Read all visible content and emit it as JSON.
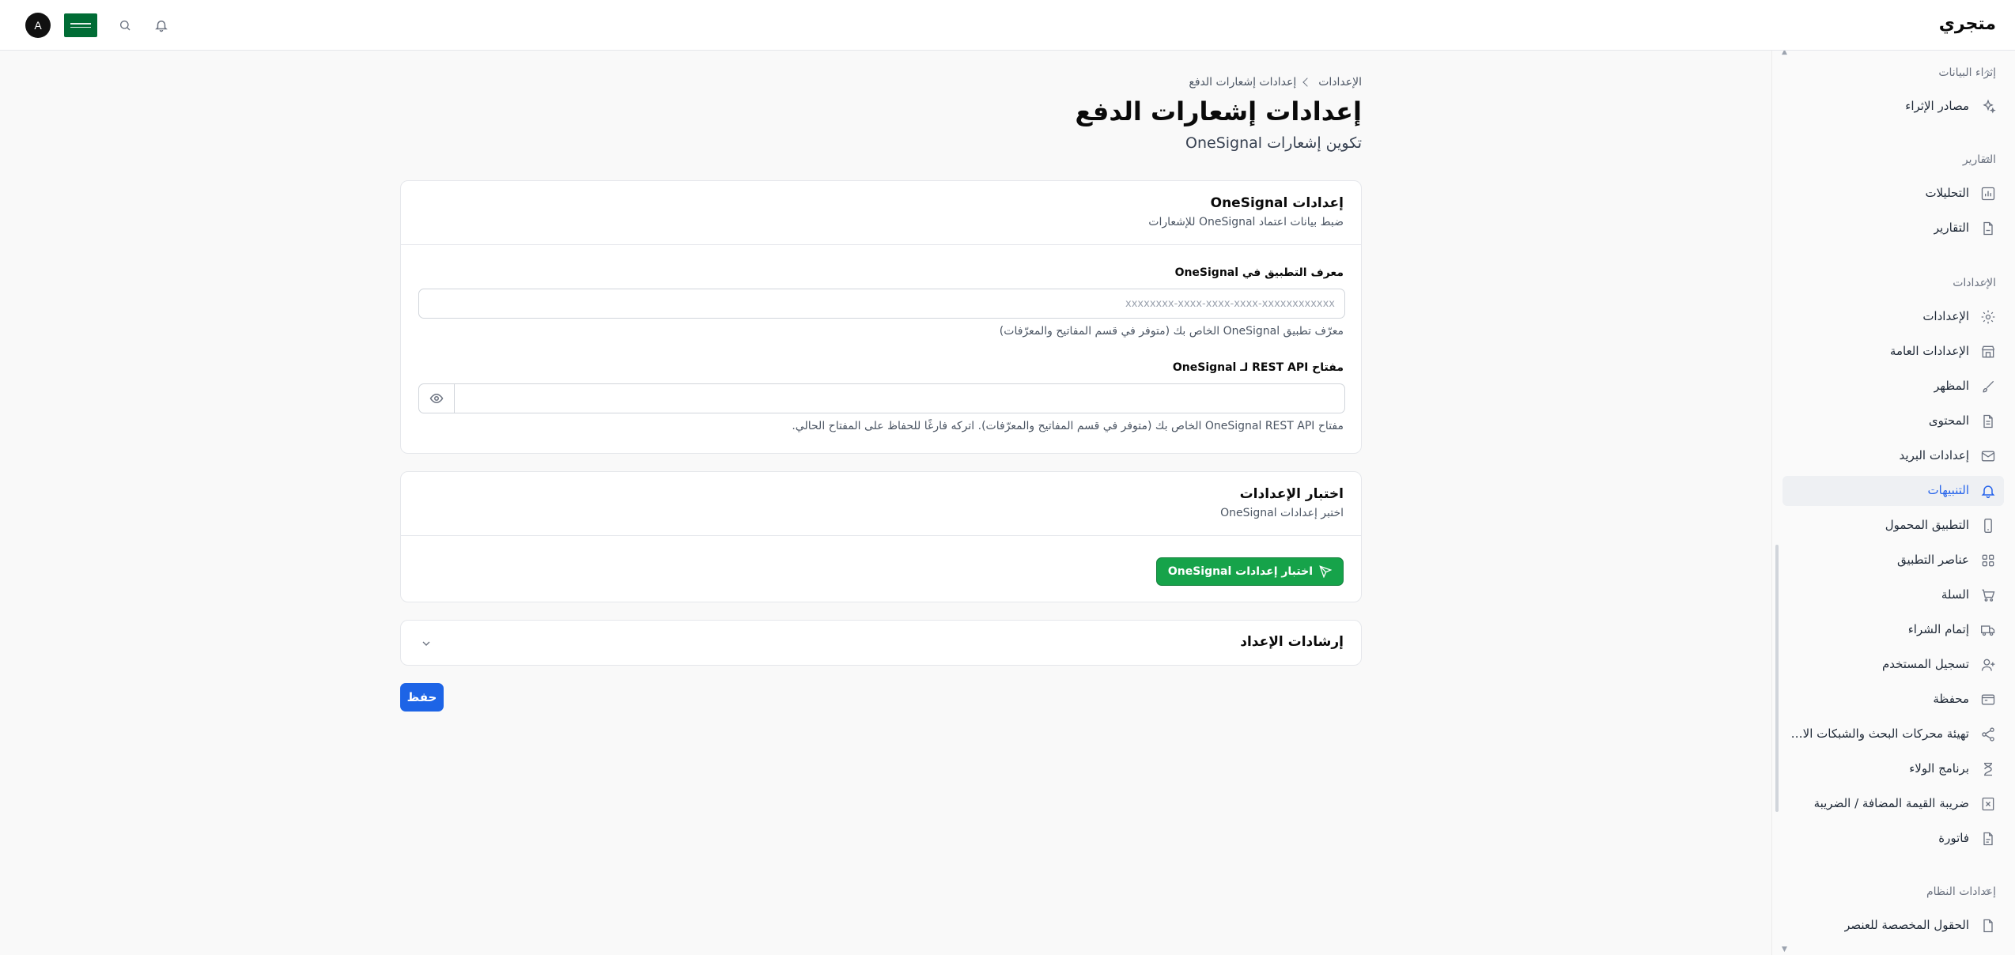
{
  "header": {
    "logo": "متجري",
    "avatar_initial": "A",
    "icons": [
      "notification-bell-icon",
      "search-icon",
      "flag-icon"
    ]
  },
  "sidebar": {
    "sections": [
      {
        "title": "إثراء البيانات",
        "items": [
          {
            "label": "مصادر الإثراء",
            "icon": "sparkles-icon"
          }
        ]
      },
      {
        "title": "التقارير",
        "items": [
          {
            "label": "التحليلات",
            "icon": "chart-icon"
          },
          {
            "label": "التقارير",
            "icon": "document-icon"
          }
        ]
      },
      {
        "title": "الإعدادات",
        "items": [
          {
            "label": "الإعدادات",
            "icon": "gear-icon"
          },
          {
            "label": "الإعدادات العامة",
            "icon": "store-icon"
          },
          {
            "label": "المظهر",
            "icon": "brush-icon"
          },
          {
            "label": "المحتوى",
            "icon": "file-text-icon"
          },
          {
            "label": "إعدادات البريد",
            "icon": "mail-icon"
          },
          {
            "label": "التنبيهات",
            "icon": "bell-icon"
          },
          {
            "label": "التطبيق المحمول",
            "icon": "smartphone-icon"
          },
          {
            "label": "عناصر التطبيق",
            "icon": "grid-icon"
          },
          {
            "label": "السلة",
            "icon": "cart-icon"
          },
          {
            "label": "إتمام الشراء",
            "icon": "truck-icon"
          },
          {
            "label": "تسجيل المستخدم",
            "icon": "user-plus-icon"
          },
          {
            "label": "محفظة",
            "icon": "wallet-icon"
          },
          {
            "label": "تهيئة محركات البحث والشبكات الاجتماعية",
            "icon": "share-icon"
          },
          {
            "label": "برنامج الولاء",
            "icon": "hourglass-icon"
          },
          {
            "label": "ضريبة القيمة المضافة / الضريبة",
            "icon": "tax-icon"
          },
          {
            "label": "فاتورة",
            "icon": "invoice-icon"
          }
        ]
      },
      {
        "title": "إعدادات النظام",
        "items": [
          {
            "label": "الحقول المخصصة للعنصر",
            "icon": "file-icon"
          }
        ]
      }
    ],
    "active_item": "التنبيهات"
  },
  "breadcrumb": {
    "parent": "الإعدادات",
    "current": "إعدادات إشعارات الدفع"
  },
  "page": {
    "title": "إعدادات إشعارات الدفع",
    "subtitle": "تكوين إشعارات OneSignal"
  },
  "onesignal_card": {
    "title": "إعدادات OneSignal",
    "description": "ضبط بيانات اعتماد OneSignal للإشعارات",
    "app_id": {
      "label": "معرف التطبيق في OneSignal",
      "value": "",
      "placeholder": "xxxxxxxx-xxxx-xxxx-xxxx-xxxxxxxxxxxx",
      "help": "معرّف تطبيق OneSignal الخاص بك (متوفر في قسم المفاتيح والمعرّفات)"
    },
    "api_key": {
      "label": "مفتاح REST API لـ OneSignal",
      "value": "",
      "placeholder": "",
      "help": "مفتاح OneSignal REST API الخاص بك (متوفر في قسم المفاتيح والمعرّفات). اتركه فارغًا للحفاظ على المفتاح الحالي."
    }
  },
  "test_card": {
    "title": "اختبار الإعدادات",
    "description": "اختبر إعدادات OneSignal",
    "button_label": "اختبار إعدادات OneSignal"
  },
  "instructions_card": {
    "title": "إرشادات الإعداد"
  },
  "save_button": "حفظ",
  "colors": {
    "accent_blue": "#1d64e6",
    "success_green": "#16a34a",
    "active_item": "#2563eb"
  }
}
